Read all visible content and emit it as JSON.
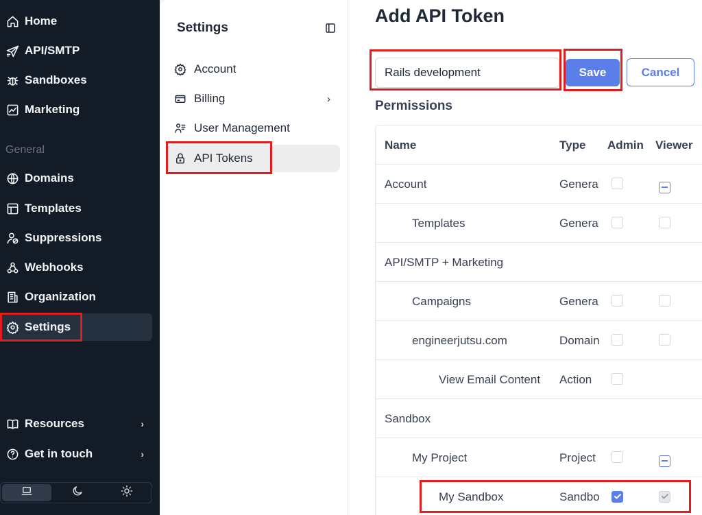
{
  "nav": {
    "items_top": [
      {
        "label": "Home",
        "icon": "home-icon"
      },
      {
        "label": "API/SMTP",
        "icon": "send-icon"
      },
      {
        "label": "Sandboxes",
        "icon": "bug-icon"
      },
      {
        "label": "Marketing",
        "icon": "chart-icon"
      }
    ],
    "section_label": "General",
    "items_general": [
      {
        "label": "Domains",
        "icon": "globe-icon"
      },
      {
        "label": "Templates",
        "icon": "template-icon"
      },
      {
        "label": "Suppressions",
        "icon": "user-block-icon"
      },
      {
        "label": "Webhooks",
        "icon": "webhook-icon"
      },
      {
        "label": "Organization",
        "icon": "building-icon"
      },
      {
        "label": "Settings",
        "icon": "gear-icon"
      }
    ],
    "items_bottom": [
      {
        "label": "Resources",
        "icon": "book-icon"
      },
      {
        "label": "Get in touch",
        "icon": "help-icon"
      }
    ],
    "theme": [
      "laptop-icon",
      "moon-icon",
      "sun-icon"
    ]
  },
  "settings": {
    "title": "Settings",
    "items": [
      {
        "label": "Account",
        "icon": "gear-icon"
      },
      {
        "label": "Billing",
        "icon": "card-icon"
      },
      {
        "label": "User Management",
        "icon": "users-icon"
      },
      {
        "label": "API Tokens",
        "icon": "lock-icon"
      }
    ]
  },
  "main": {
    "title": "Add API Token",
    "token_name_value": "Rails development",
    "save_label": "Save",
    "cancel_label": "Cancel",
    "permissions_title": "Permissions",
    "columns": {
      "name": "Name",
      "type": "Type",
      "admin": "Admin",
      "viewer": "Viewer"
    },
    "rows": [
      {
        "name": "Account",
        "type": "General",
        "admin": "unchecked",
        "viewer": "indeterminate"
      },
      {
        "name": "Templates",
        "type": "General",
        "admin": "unchecked",
        "viewer": "unchecked"
      },
      {
        "name": "API/SMTP + Marketing",
        "type": "",
        "admin": "",
        "viewer": ""
      },
      {
        "name": "Campaigns",
        "type": "General",
        "admin": "unchecked",
        "viewer": "unchecked"
      },
      {
        "name": "engineerjutsu.com",
        "type": "Domain",
        "admin": "unchecked",
        "viewer": "unchecked"
      },
      {
        "name": "View Email Content",
        "type": "Action",
        "admin": "unchecked",
        "viewer": ""
      },
      {
        "name": "Sandbox",
        "type": "",
        "admin": "",
        "viewer": ""
      },
      {
        "name": "My Project",
        "type": "Project",
        "admin": "unchecked",
        "viewer": "indeterminate"
      },
      {
        "name": "My Sandbox",
        "type": "Sandbox",
        "admin": "checked",
        "viewer": "disabled-checked"
      }
    ]
  },
  "colors": {
    "nav_bg": "#131b26",
    "accent": "#5b7fe8",
    "highlight": "#e11d1d"
  }
}
